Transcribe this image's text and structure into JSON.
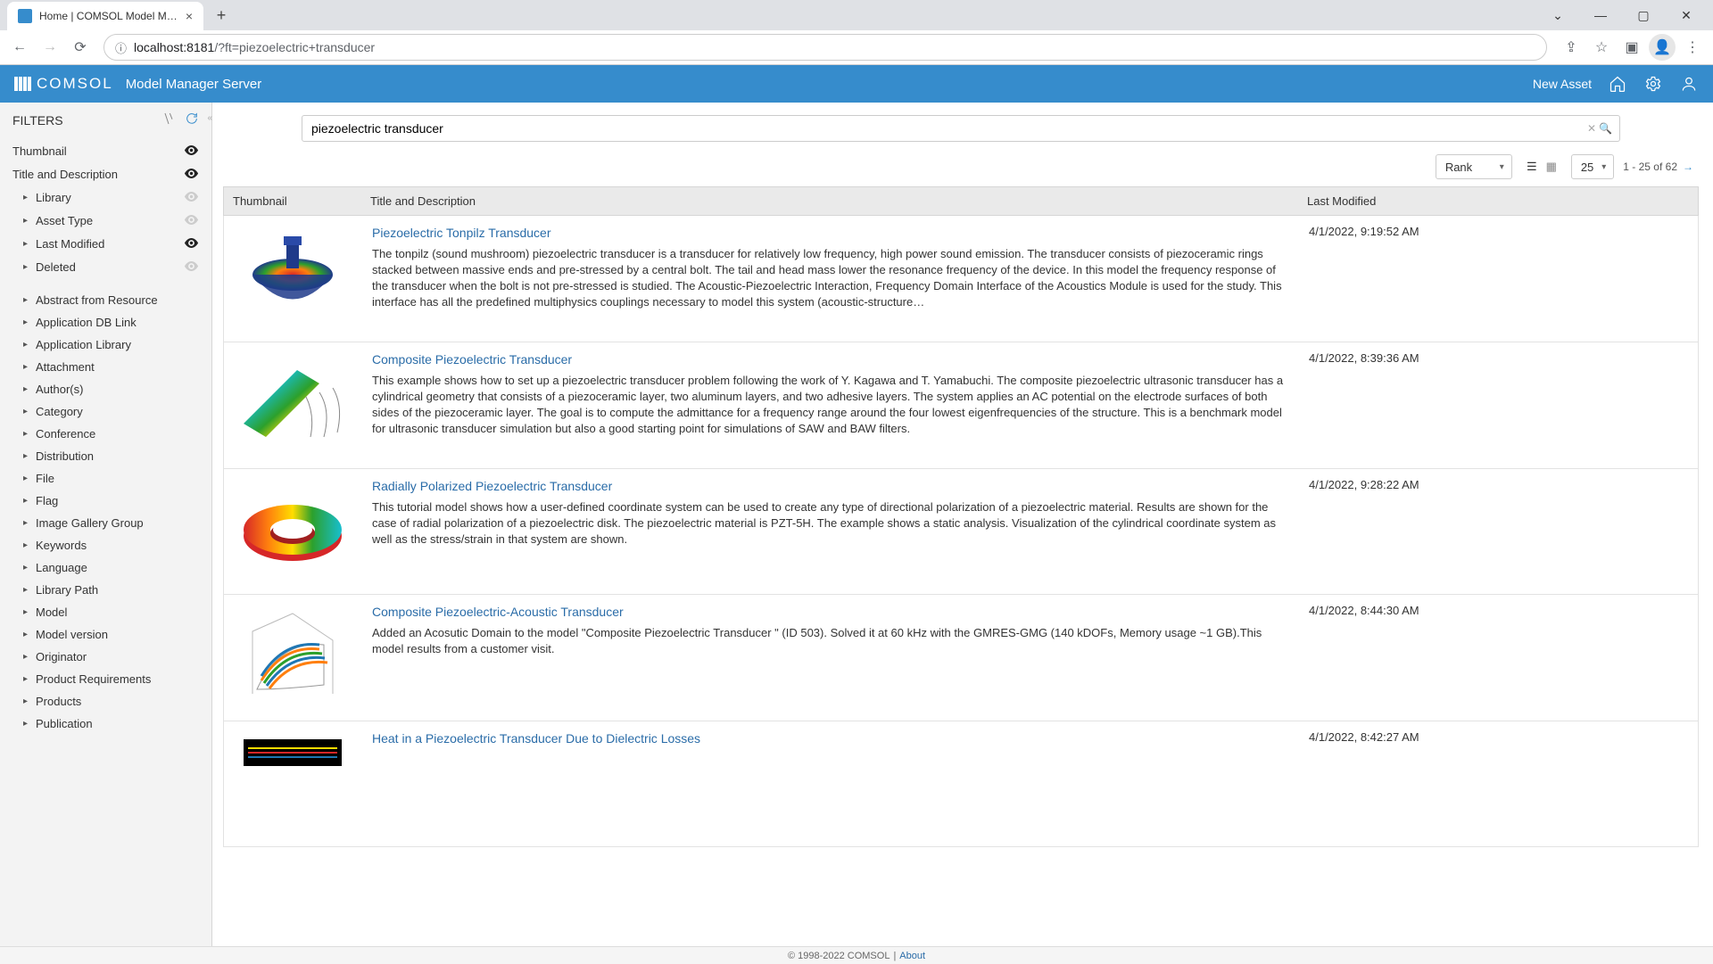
{
  "browser": {
    "tab_title": "Home | COMSOL Model Manage",
    "url_host": "localhost:8181",
    "url_path": "/?ft=piezoelectric+transducer"
  },
  "header": {
    "logo_text": "COMSOL",
    "app_title": "Model Manager Server",
    "new_asset_label": "New Asset"
  },
  "filters": {
    "title": "FILTERS",
    "primary": [
      {
        "label": "Thumbnail",
        "eye": "on",
        "caret": false
      },
      {
        "label": "Title and Description",
        "eye": "on",
        "caret": false
      },
      {
        "label": "Library",
        "eye": "dim",
        "caret": true
      },
      {
        "label": "Asset Type",
        "eye": "dim",
        "caret": true
      },
      {
        "label": "Last Modified",
        "eye": "on",
        "caret": true
      },
      {
        "label": "Deleted",
        "eye": "dim",
        "caret": true
      }
    ],
    "secondary": [
      "Abstract from Resource",
      "Application DB Link",
      "Application Library",
      "Attachment",
      "Author(s)",
      "Category",
      "Conference",
      "Distribution",
      "File",
      "Flag",
      "Image Gallery Group",
      "Keywords",
      "Language",
      "Library Path",
      "Model",
      "Model version",
      "Originator",
      "Product Requirements",
      "Products",
      "Publication"
    ]
  },
  "search": {
    "value": "piezoelectric transducer"
  },
  "toolbar": {
    "sort": "Rank",
    "page_size": "25",
    "range": "1 - 25 of 62"
  },
  "columns": {
    "thumb": "Thumbnail",
    "title": "Title and Description",
    "mod": "Last Modified"
  },
  "results": [
    {
      "title": "Piezoelectric Tonpilz Transducer",
      "modified": "4/1/2022, 9:19:52 AM",
      "desc": "The tonpilz (sound mushroom) piezoelectric transducer is a transducer for relatively low frequency, high power sound emission. The transducer consists of piezoceramic rings stacked between massive ends and pre-stressed by a central bolt. The tail and head mass lower the resonance frequency of the device. In this model the frequency response of the transducer when the bolt is not pre-stressed is studied. The Acoustic-Piezoelectric Interaction, Frequency Domain Interface of the Acoustics Module is used for the study. This interface has all the predefined multiphysics couplings necessary to model this system (acoustic-structure…"
    },
    {
      "title": "Composite Piezoelectric Transducer",
      "modified": "4/1/2022, 8:39:36 AM",
      "desc": "This example shows how to set up a piezoelectric transducer problem following the work of Y. Kagawa and T. Yamabuchi. The composite piezoelectric ultrasonic transducer has a cylindrical geometry that consists of a piezoceramic layer, two aluminum layers, and two adhesive layers. The system applies an AC potential on the electrode surfaces of both sides of the piezoceramic layer. The goal is to compute the admittance for a frequency range around the four lowest eigenfrequencies of the structure. This is a benchmark model for ultrasonic transducer simulation but also a good starting point for simulations of SAW and BAW filters."
    },
    {
      "title": "Radially Polarized Piezoelectric Transducer",
      "modified": "4/1/2022, 9:28:22 AM",
      "desc": "This tutorial model shows how a user-defined coordinate system can be used to create any type of directional polarization of a piezoelectric material. Results are shown for the case of radial polarization of a piezoelectric disk. The piezoelectric material is PZT-5H. The example shows a static analysis. Visualization of the cylindrical coordinate system as well as the stress/strain in that system are shown."
    },
    {
      "title": "Composite Piezoelectric-Acoustic Transducer",
      "modified": "4/1/2022, 8:44:30 AM",
      "desc": "Added an Acosutic Domain to the model \"Composite Piezoelectric Transducer \" (ID 503). Solved it at 60 kHz with the GMRES-GMG (140 kDOFs, Memory usage ~1 GB).This model results from a customer visit."
    },
    {
      "title": "Heat in a Piezoelectric Transducer Due to Dielectric Losses",
      "modified": "4/1/2022, 8:42:27 AM",
      "desc": ""
    }
  ],
  "footer": {
    "copyright": "© 1998-2022 COMSOL",
    "about": "About"
  }
}
